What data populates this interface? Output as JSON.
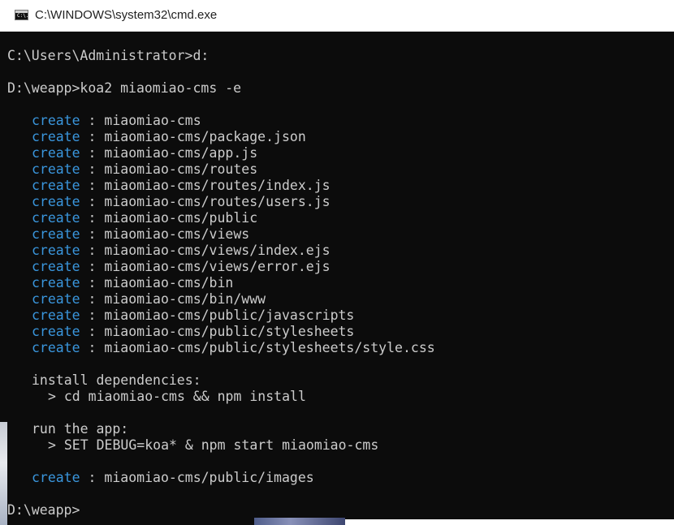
{
  "window": {
    "title": "C:\\WINDOWS\\system32\\cmd.exe",
    "icon": "cmd-icon",
    "icon_text": "C:\\."
  },
  "console": {
    "lines": [
      {
        "type": "text",
        "text": "C:\\Users\\Administrator>d:"
      },
      {
        "type": "blank"
      },
      {
        "type": "text",
        "text": "D:\\weapp>koa2 miaomiao-cms -e"
      },
      {
        "type": "blank"
      },
      {
        "type": "create",
        "keyword": "create",
        "path": "miaomiao-cms"
      },
      {
        "type": "create",
        "keyword": "create",
        "path": "miaomiao-cms/package.json"
      },
      {
        "type": "create",
        "keyword": "create",
        "path": "miaomiao-cms/app.js"
      },
      {
        "type": "create",
        "keyword": "create",
        "path": "miaomiao-cms/routes"
      },
      {
        "type": "create",
        "keyword": "create",
        "path": "miaomiao-cms/routes/index.js"
      },
      {
        "type": "create",
        "keyword": "create",
        "path": "miaomiao-cms/routes/users.js"
      },
      {
        "type": "create",
        "keyword": "create",
        "path": "miaomiao-cms/public"
      },
      {
        "type": "create",
        "keyword": "create",
        "path": "miaomiao-cms/views"
      },
      {
        "type": "create",
        "keyword": "create",
        "path": "miaomiao-cms/views/index.ejs"
      },
      {
        "type": "create",
        "keyword": "create",
        "path": "miaomiao-cms/views/error.ejs"
      },
      {
        "type": "create",
        "keyword": "create",
        "path": "miaomiao-cms/bin"
      },
      {
        "type": "create",
        "keyword": "create",
        "path": "miaomiao-cms/bin/www"
      },
      {
        "type": "create",
        "keyword": "create",
        "path": "miaomiao-cms/public/javascripts"
      },
      {
        "type": "create",
        "keyword": "create",
        "path": "miaomiao-cms/public/stylesheets"
      },
      {
        "type": "create",
        "keyword": "create",
        "path": "miaomiao-cms/public/stylesheets/style.css"
      },
      {
        "type": "blank"
      },
      {
        "type": "indent2",
        "text": "install dependencies:"
      },
      {
        "type": "indent4",
        "text": "> cd miaomiao-cms && npm install"
      },
      {
        "type": "blank"
      },
      {
        "type": "indent2",
        "text": "run the app:"
      },
      {
        "type": "indent4",
        "text": "> SET DEBUG=koa* & npm start miaomiao-cms"
      },
      {
        "type": "blank"
      },
      {
        "type": "create",
        "keyword": "create",
        "path": "miaomiao-cms/public/images"
      },
      {
        "type": "blank"
      },
      {
        "type": "text",
        "text": "D:\\weapp>"
      }
    ]
  },
  "colors": {
    "background": "#0c0c0c",
    "foreground": "#cccccc",
    "keyword": "#3a96dd"
  }
}
